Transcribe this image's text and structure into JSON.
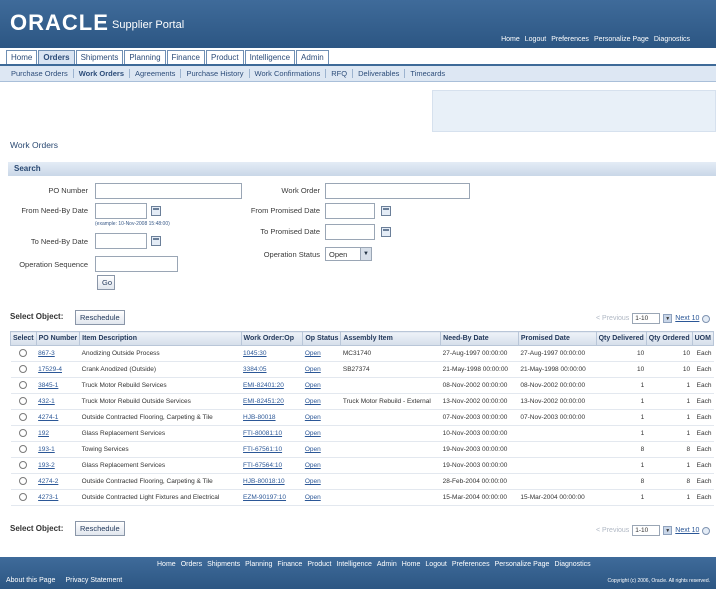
{
  "header": {
    "logo": "ORACLE",
    "portal_title": "Supplier Portal",
    "global_links": [
      "Home",
      "Logout",
      "Preferences",
      "Personalize Page",
      "Diagnostics"
    ]
  },
  "tabs": [
    {
      "label": "Home",
      "active": false
    },
    {
      "label": "Orders",
      "active": true
    },
    {
      "label": "Shipments",
      "active": false
    },
    {
      "label": "Planning",
      "active": false
    },
    {
      "label": "Finance",
      "active": false
    },
    {
      "label": "Product",
      "active": false
    },
    {
      "label": "Intelligence",
      "active": false
    },
    {
      "label": "Admin",
      "active": false
    }
  ],
  "subtabs": [
    {
      "label": "Purchase Orders",
      "active": false
    },
    {
      "label": "Work Orders",
      "active": true
    },
    {
      "label": "Agreements",
      "active": false
    },
    {
      "label": "Purchase History",
      "active": false
    },
    {
      "label": "Work Confirmations",
      "active": false
    },
    {
      "label": "RFQ",
      "active": false
    },
    {
      "label": "Deliverables",
      "active": false
    },
    {
      "label": "Timecards",
      "active": false
    }
  ],
  "page_title": "Work Orders",
  "search": {
    "section_title": "Search",
    "po_number_label": "PO Number",
    "work_order_label": "Work Order",
    "from_need_by_label": "From Need-By Date",
    "from_promised_label": "From Promised Date",
    "date_example": "(example: 10-Nov-2008 15:48:00)",
    "to_need_by_label": "To Need-By Date",
    "to_promised_label": "To Promised Date",
    "operation_status_label": "Operation Status",
    "operation_status_value": "Open",
    "operation_sequence_label": "Operation Sequence",
    "go_label": "Go"
  },
  "table_actions": {
    "select_object_label": "Select Object:",
    "reschedule_label": "Reschedule",
    "previous_label": "Previous",
    "range_value": "1-10",
    "next_label": "Next 10"
  },
  "columns": [
    "Select",
    "PO Number",
    "Item Description",
    "Work Order:Op",
    "Op Status",
    "Assembly Item",
    "Need-By Date",
    "Promised Date",
    "Qty Delivered",
    "Qty Ordered",
    "UOM"
  ],
  "rows": [
    {
      "po": "867-3",
      "item": "Anodizing Outside Process",
      "wo": "1045:30",
      "status": "Open",
      "assembly": "MC31740",
      "need_by": "27-Aug-1997 00:00:00",
      "promised": "27-Aug-1997 00:00:00",
      "delivered": "10",
      "ordered": "10",
      "uom": "Each"
    },
    {
      "po": "17529-4",
      "item": "Crank Anodized (Outside)",
      "wo": "3384:05",
      "status": "Open",
      "assembly": "SB27374",
      "need_by": "21-May-1998 00:00:00",
      "promised": "21-May-1998 00:00:00",
      "delivered": "10",
      "ordered": "10",
      "uom": "Each"
    },
    {
      "po": "3845-1",
      "item": "Truck Motor Rebuild Services",
      "wo": "EMI-82401:20",
      "status": "Open",
      "assembly": "",
      "need_by": "08-Nov-2002 00:00:00",
      "promised": "08-Nov-2002 00:00:00",
      "delivered": "1",
      "ordered": "1",
      "uom": "Each"
    },
    {
      "po": "432-1",
      "item": "Truck Motor Rebuild Outside Services",
      "wo": "EMI-82451:20",
      "status": "Open",
      "assembly": "Truck Motor Rebuild - External",
      "need_by": "13-Nov-2002 00:00:00",
      "promised": "13-Nov-2002 00:00:00",
      "delivered": "1",
      "ordered": "1",
      "uom": "Each"
    },
    {
      "po": "4274-1",
      "item": "Outside Contracted Flooring, Carpeting & Tile",
      "wo": "HJB-80018",
      "status": "Open",
      "assembly": "",
      "need_by": "07-Nov-2003 00:00:00",
      "promised": "07-Nov-2003 00:00:00",
      "delivered": "1",
      "ordered": "1",
      "uom": "Each"
    },
    {
      "po": "192",
      "item": "Glass Replacement Services",
      "wo": "FTI-80081:10",
      "status": "Open",
      "assembly": "",
      "need_by": "10-Nov-2003 00:00:00",
      "promised": "",
      "delivered": "1",
      "ordered": "1",
      "uom": "Each"
    },
    {
      "po": "193-1",
      "item": "Towing Services",
      "wo": "FTI-67561:10",
      "status": "Open",
      "assembly": "",
      "need_by": "19-Nov-2003 00:00:00",
      "promised": "",
      "delivered": "8",
      "ordered": "8",
      "uom": "Each"
    },
    {
      "po": "193-2",
      "item": "Glass Replacement Services",
      "wo": "FTI-67564:10",
      "status": "Open",
      "assembly": "",
      "need_by": "19-Nov-2003 00:00:00",
      "promised": "",
      "delivered": "1",
      "ordered": "1",
      "uom": "Each"
    },
    {
      "po": "4274-2",
      "item": "Outside Contracted Flooring, Carpeting & Tile",
      "wo": "HJB-80018:10",
      "status": "Open",
      "assembly": "",
      "need_by": "28-Feb-2004 00:00:00",
      "promised": "",
      "delivered": "8",
      "ordered": "8",
      "uom": "Each"
    },
    {
      "po": "4273-1",
      "item": "Outside Contracted Light Fixtures and Electrical",
      "wo": "EZM-90197:10",
      "status": "Open",
      "assembly": "",
      "need_by": "15-Mar-2004 00:00:00",
      "promised": "15-Mar-2004 00:00:00",
      "delivered": "1",
      "ordered": "1",
      "uom": "Each"
    }
  ],
  "footer": {
    "links": [
      "Home",
      "Orders",
      "Shipments",
      "Planning",
      "Finance",
      "Product",
      "Intelligence",
      "Admin",
      "Home",
      "Logout",
      "Preferences",
      "Personalize Page",
      "Diagnostics"
    ],
    "bottom_links": [
      "About this Page",
      "Privacy Statement"
    ],
    "copyright": "Copyright (c) 2006, Oracle. All rights reserved."
  }
}
